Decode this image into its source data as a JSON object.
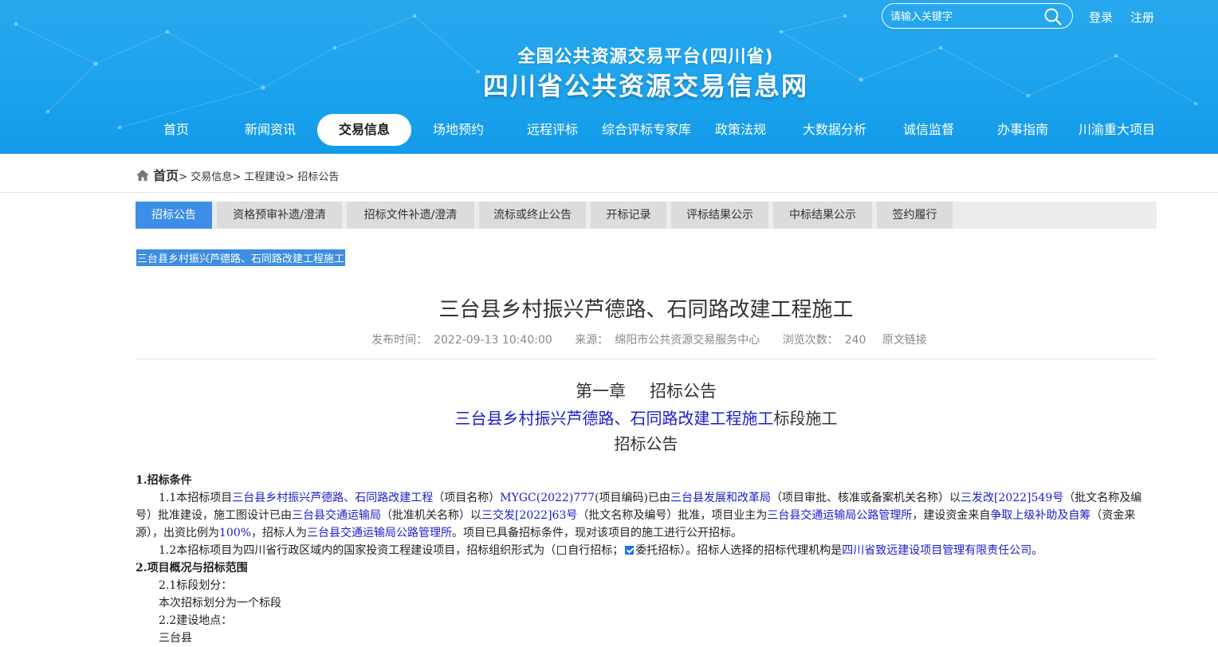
{
  "header": {
    "search_placeholder": "请输入关键字",
    "login": "登录",
    "register": "注册",
    "subtitle": "全国公共资源交易平台(四川省)",
    "title": "四川省公共资源交易信息网"
  },
  "nav": [
    "首页",
    "新闻资讯",
    "交易信息",
    "场地预约",
    "远程评标",
    "综合评标专家库",
    "政策法规",
    "大数据分析",
    "诚信监督",
    "办事指南",
    "川渝重大项目"
  ],
  "nav_active": "交易信息",
  "breadcrumb": {
    "home": "首页",
    "sep": ">",
    "items": [
      "交易信息",
      "工程建设",
      "招标公告"
    ]
  },
  "tabs": [
    "招标公告",
    "资格预审补遗/澄清",
    "招标文件补遗/澄清",
    "流标或终止公告",
    "开标记录",
    "评标结果公示",
    "中标结果公示",
    "签约履行"
  ],
  "selected_link": "三台县乡村振兴芦德路、石同路改建工程施工",
  "article": {
    "title": "三台县乡村振兴芦德路、石同路改建工程施工",
    "meta": {
      "time_label": "发布时间：",
      "time": "2022-09-13 10:40:00",
      "source_label": "来源：",
      "source": "绵阳市公共资源交易服务中心",
      "views_label": "浏览次数：",
      "views": "240",
      "original_link": "原文链接"
    },
    "chapter": "第一章",
    "chapter_name": "招标公告",
    "subtitle_blue": "三台县乡村振兴芦德路、石同路改建工程施工",
    "subtitle_tail": "标段施工",
    "subtitle2": "招标公告",
    "sec1": "1.招标条件",
    "p11": {
      "a": "1.1本招标项目",
      "b": "三台县乡村振兴芦德路、石同路改建工程",
      "c": "（项目名称）",
      "d": "MYGC(2022)777",
      "e": "(项目编码)已由",
      "f": "三台县发展和改革局",
      "g": "（项目审批、核准或备案机关名称）以",
      "h": "三发改[2022]549号",
      "i": "（批文名称及编号）批准建设，施工图设计已由",
      "j": "三台县交通运输局",
      "k": "（批准机关名称）以",
      "l": "三交发[2022]63号",
      "m": "（批文名称及编号）批准，项目业主为",
      "n": "三台县交通运输局公路管理所",
      "o": "，建设资金来自",
      "p": "争取上级补助及自筹",
      "q": "（资金来源），出资比例为",
      "r": "100%",
      "s": "，招标人为",
      "t": "三台县交通运输局公路管理所",
      "u": "。项目已具备招标条件，现对该项目的施工进行公开招标。"
    },
    "p12": {
      "a": "1.2本招标项目为四川省行政区域内的国家投资工程建设项目，招标组织形式为（",
      "b": "自行招标；",
      "c": "委托招标）。招标人选择的招标代理机构是",
      "d": "四川省致远建设项目管理有限责任公司",
      "e": "。"
    },
    "sec2": "2.项目概况与招标范围",
    "p21_label": "2.1标段划分：",
    "p21_value": "本次招标划分为一个标段",
    "p22_label": "2.2建设地点：",
    "p22_value": "三台县"
  }
}
